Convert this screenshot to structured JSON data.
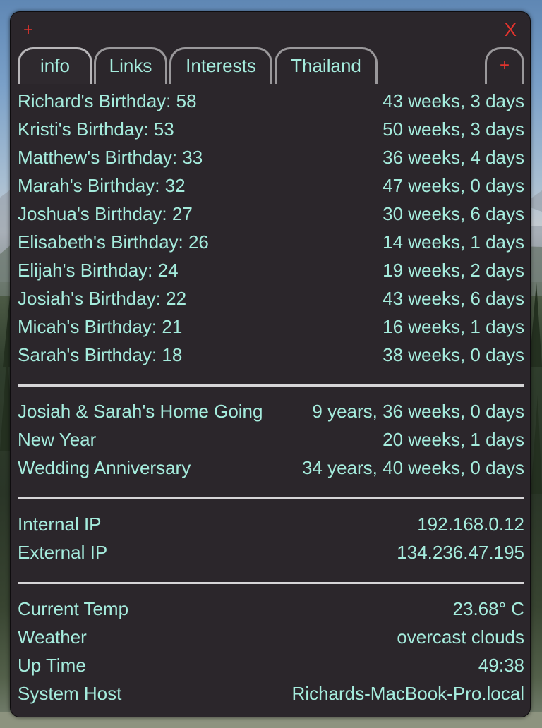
{
  "window": {
    "add_label": "+",
    "close_label": "X"
  },
  "tabs": [
    {
      "label": "info",
      "active": true
    },
    {
      "label": "Links"
    },
    {
      "label": "Interests"
    },
    {
      "label": "Thailand"
    }
  ],
  "add_tab_label": "+",
  "birthdays": [
    {
      "label": "Richard's Birthday: 58",
      "value": "43 weeks, 3 days"
    },
    {
      "label": "Kristi's Birthday: 53",
      "value": "50 weeks, 3 days"
    },
    {
      "label": "Matthew's Birthday: 33",
      "value": "36 weeks, 4 days"
    },
    {
      "label": "Marah's Birthday: 32",
      "value": "47 weeks, 0 days"
    },
    {
      "label": "Joshua's Birthday: 27",
      "value": "30 weeks, 6 days"
    },
    {
      "label": "Elisabeth's Birthday: 26",
      "value": "14 weeks, 1 days"
    },
    {
      "label": "Elijah's Birthday: 24",
      "value": "19 weeks, 2 days"
    },
    {
      "label": "Josiah's Birthday: 22",
      "value": "43 weeks, 6 days"
    },
    {
      "label": "Micah's Birthday: 21",
      "value": "16 weeks, 1 days"
    },
    {
      "label": "Sarah's Birthday: 18",
      "value": "38 weeks, 0 days"
    }
  ],
  "events": [
    {
      "label": "Josiah & Sarah's Home Going",
      "value": "9 years, 36 weeks, 0 days"
    },
    {
      "label": "New Year",
      "value": "20 weeks, 1 days"
    },
    {
      "label": "Wedding Anniversary",
      "value": "34 years, 40 weeks, 0 days"
    }
  ],
  "network": [
    {
      "label": "Internal IP",
      "value": "192.168.0.12"
    },
    {
      "label": "External IP",
      "value": "134.236.47.195"
    }
  ],
  "system": [
    {
      "label": "Current Temp",
      "value": "23.68° C"
    },
    {
      "label": "Weather",
      "value": "overcast clouds"
    },
    {
      "label": "Up Time",
      "value": "49:38"
    },
    {
      "label": "System Host",
      "value": "Richards-MacBook-Pro.local"
    }
  ],
  "colors": {
    "text": "#a5ecdd",
    "accent_red": "#e0332d",
    "panel": "#2b262b",
    "divider": "#d6d5d7"
  }
}
